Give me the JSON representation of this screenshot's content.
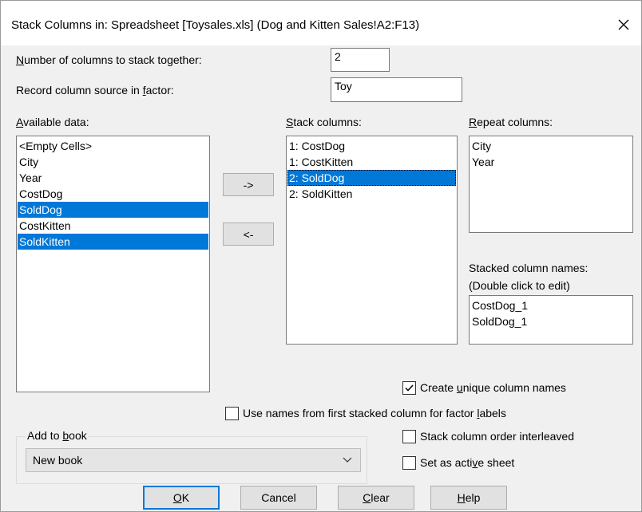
{
  "window": {
    "title": "Stack Columns in: Spreadsheet [Toysales.xls] (Dog and Kitten Sales!A2:F13)"
  },
  "fields": {
    "num_columns_label_pre": "",
    "num_columns_label_key": "N",
    "num_columns_label_post": "umber of columns to stack together:",
    "num_columns_value": "2",
    "record_source_label_pre": "Record column source in ",
    "record_source_label_key": "f",
    "record_source_label_post": "actor:",
    "record_source_value": "Toy"
  },
  "available": {
    "label_key": "A",
    "label_post": "vailable data:",
    "items": [
      {
        "label": "<Empty Cells>",
        "selected": false
      },
      {
        "label": "City",
        "selected": false
      },
      {
        "label": "Year",
        "selected": false
      },
      {
        "label": "CostDog",
        "selected": false
      },
      {
        "label": "SoldDog",
        "selected": true
      },
      {
        "label": "CostKitten",
        "selected": false
      },
      {
        "label": "SoldKitten",
        "selected": true
      }
    ]
  },
  "move_buttons": {
    "add": "->",
    "remove": "<-"
  },
  "stack": {
    "label_key": "S",
    "label_post": "tack columns:",
    "items": [
      {
        "label": "1: CostDog",
        "selected": false
      },
      {
        "label": "1: CostKitten",
        "selected": false
      },
      {
        "label": "2: SoldDog",
        "selected": true
      },
      {
        "label": "2: SoldKitten",
        "selected": false
      }
    ]
  },
  "repeat": {
    "label_key": "R",
    "label_post": "epeat columns:",
    "items": [
      {
        "label": "City"
      },
      {
        "label": "Year"
      }
    ]
  },
  "stacked_names": {
    "label_line1": "Stacked column names:",
    "label_line2": "(Double click to edit)",
    "items": [
      {
        "label": "CostDog_1"
      },
      {
        "label": "SoldDog_1"
      }
    ]
  },
  "options": {
    "unique_pre": "Create ",
    "unique_key": "u",
    "unique_post": "nique column names",
    "unique_checked": true,
    "first_names_pre": "Use names from first stacked column for factor ",
    "first_names_key": "l",
    "first_names_post": "abels",
    "first_names_checked": false,
    "interleaved_label": "Stack column order interleaved",
    "interleaved_checked": false,
    "active_pre": "Set as acti",
    "active_key": "v",
    "active_post": "e sheet",
    "active_checked": false
  },
  "add_to_book": {
    "label_pre": "Add to ",
    "label_key": "b",
    "label_post": "ook",
    "selected": "New book"
  },
  "buttons": {
    "ok_key": "O",
    "ok_post": "K",
    "cancel": "Cancel",
    "clear_key": "C",
    "clear_post": "lear",
    "help_key": "H",
    "help_post": "elp"
  },
  "colors": {
    "selection": "#0078d7",
    "dialog_bg": "#f0f0f0"
  },
  "icons": {
    "close": "close-icon",
    "chevron": "chevron-down-icon",
    "check": "checkmark-icon"
  }
}
